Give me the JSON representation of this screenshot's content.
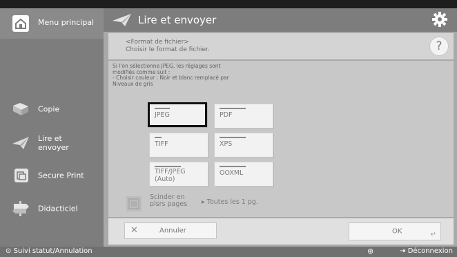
{
  "header": {
    "title": "Lire et envoyer"
  },
  "sidebar": {
    "home_label": "Menu principal",
    "items": [
      {
        "label": "Copie"
      },
      {
        "label": "Lire et\nenvoyer"
      },
      {
        "label": "Secure Print"
      },
      {
        "label": "Didacticiel"
      }
    ]
  },
  "panel": {
    "subheading_line1": "<Format de fichier>",
    "subheading_line2": "Choisir le format de fichier.",
    "help_label": "?",
    "note": "Si l'on sélectionne JPEG, les réglages sont\nmodifiés comme suit :\n- Choisir couleur : Noir et blanc remplacé par\nNiveaux de gris",
    "formats": [
      {
        "label": "JPEG",
        "selected": true
      },
      {
        "label": "PDF",
        "selected": false
      },
      {
        "label": "TIFF",
        "selected": false
      },
      {
        "label": "XPS",
        "selected": false
      },
      {
        "label": "TIFF/JPEG\n(Auto)",
        "selected": false
      },
      {
        "label": "OOXML",
        "selected": false
      }
    ],
    "split_label": "Scinder en\nplsrs pages",
    "split_value": "▸ Toutes les 1 pg.",
    "cancel_label": "Annuler",
    "ok_label": "OK"
  },
  "status": {
    "left": "Suivi statut/Annulation",
    "right": "Déconnexion"
  }
}
